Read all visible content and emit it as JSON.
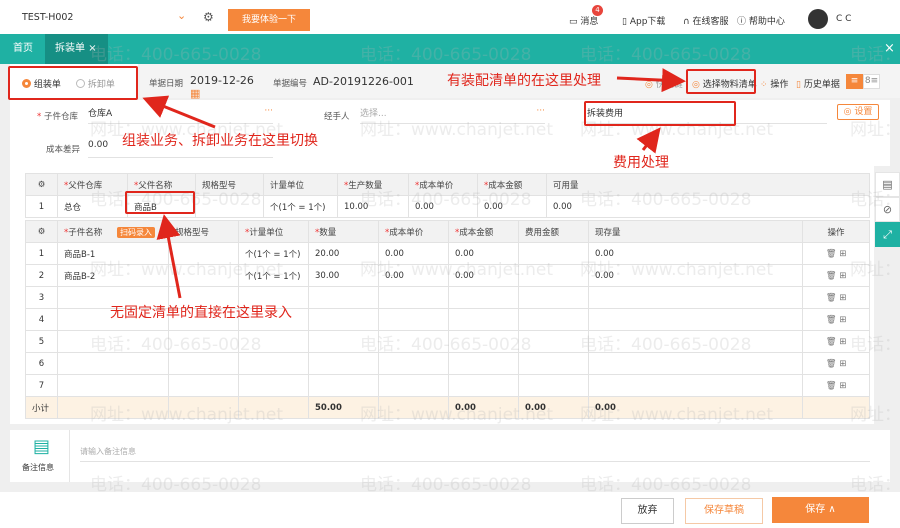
{
  "topbar": {
    "account": "TEST-H002",
    "try_button": "我要体验一下",
    "messages": "消息",
    "message_count": "4",
    "app_download": "App下载",
    "online_service": "在线客服",
    "help_center": "帮助中心",
    "user": "C C"
  },
  "tabs": [
    {
      "label": "首页"
    },
    {
      "label": "拆装单"
    }
  ],
  "header": {
    "radio_assemble": "组装单",
    "radio_disassemble": "拆卸单",
    "selected": "组装单",
    "date_label": "单据日期",
    "date_value": "2019-12-26",
    "number_label": "单据编号",
    "number_value": "AD-20191226-001",
    "shortcut": "快捷键",
    "select_bom": "选择物料清单",
    "operation": "操作",
    "history": "历史单据"
  },
  "form": {
    "child_warehouse_label": "子件仓库",
    "child_warehouse_value": "仓库A",
    "handler_label": "经手人",
    "handler_placeholder": "选择...",
    "expense_value": "拆装费用",
    "settings": "设置",
    "cost_diff_label": "成本差异",
    "cost_diff_value": "0.00"
  },
  "parent_table": {
    "headers": [
      "父件仓库",
      "父件名称",
      "规格型号",
      "计量单位",
      "生产数量",
      "成本单价",
      "成本金额",
      "可用量"
    ],
    "required": [
      true,
      true,
      false,
      false,
      true,
      true,
      true,
      false
    ],
    "rows": [
      [
        "1",
        "总仓",
        "商品B",
        "",
        "个(1个 = 1个)",
        "10.00",
        "0.00",
        "0.00",
        "0.00"
      ]
    ]
  },
  "child_table": {
    "headers": [
      "子件名称",
      "规格型号",
      "计量单位",
      "数量",
      "成本单价",
      "成本金额",
      "费用金额",
      "现存量",
      "操作"
    ],
    "scan_badge": "扫码录入",
    "rows": [
      [
        "1",
        "商品B-1",
        "",
        "个(1个 = 1个)",
        "20.00",
        "0.00",
        "0.00",
        "",
        "0.00"
      ],
      [
        "2",
        "商品B-2",
        "",
        "个(1个 = 1个)",
        "30.00",
        "0.00",
        "0.00",
        "",
        "0.00"
      ],
      [
        "3",
        "",
        "",
        "",
        "",
        "",
        "",
        "",
        ""
      ],
      [
        "4",
        "",
        "",
        "",
        "",
        "",
        "",
        "",
        ""
      ],
      [
        "5",
        "",
        "",
        "",
        "",
        "",
        "",
        "",
        ""
      ],
      [
        "6",
        "",
        "",
        "",
        "",
        "",
        "",
        "",
        ""
      ],
      [
        "7",
        "",
        "",
        "",
        "",
        "",
        "",
        "",
        ""
      ]
    ],
    "subtotal": {
      "label": "小计",
      "quantity": "50.00",
      "cost_amount": "0.00",
      "expense_amount": "0.00",
      "stock": "0.00"
    }
  },
  "remarks": {
    "label": "备注信息",
    "placeholder": "请输入备注信息"
  },
  "footer": {
    "discard": "放弃",
    "save_draft": "保存草稿",
    "save": "保存 ∧"
  },
  "annotations": {
    "switch": "组装业务、拆卸业务在这里切换",
    "bom": "有装配清单的在这里处理",
    "expense": "费用处理",
    "direct": "无固定清单的直接在这里录入"
  },
  "watermark": {
    "phone": "电话：400-665-0028",
    "site": "网址：www.chanjet.net"
  },
  "colors": {
    "teal": "#1fb1a3",
    "orange": "#f5873b",
    "red": "#e0261c"
  }
}
